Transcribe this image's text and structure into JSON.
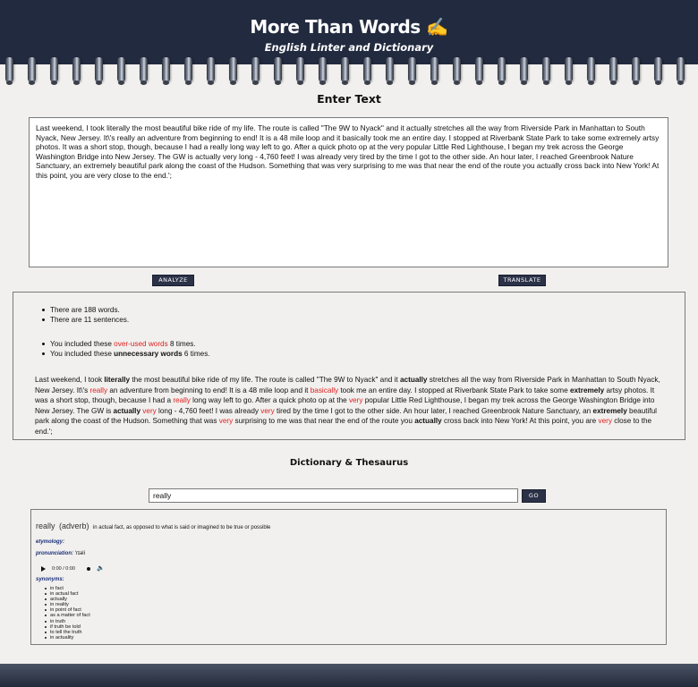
{
  "header": {
    "title": "More Than Words ✍️",
    "subtitle": "English Linter and Dictionary"
  },
  "enter_text": {
    "heading": "Enter Text",
    "input_value": "Last weekend, I took literally the most beautiful bike ride of my life. The route is called \"The 9W to Nyack\" and it actually stretches all the way from Riverside Park in Manhattan to South Nyack, New Jersey. It\\'s really an adventure from beginning to end! It is a 48 mile loop and it basically took me an entire day. I stopped at Riverbank State Park to take some extremely artsy photos. It was a short stop, though, because I had a really long way left to go. After a quick photo op at the very popular Little Red Lighthouse, I began my trek across the George Washington Bridge into New Jersey.  The GW is actually very long - 4,760 feet! I was already very tired by the time I got to the other side. An hour later, I reached Greenbrook Nature Sanctuary, an extremely beautiful park along the coast of the Hudson.  Something that was very surprising to me was that near the end of the route you actually cross back into New York! At this point, you are very close to the end.';",
    "analyze_label": "ANALYZE",
    "translate_label": "TRANSLATE"
  },
  "results": {
    "word_count": "There are 188 words.",
    "sentence_count": "There are 11 sentences.",
    "overused_prefix": "You included these ",
    "overused_link": "over-used words",
    "overused_suffix": " 8 times.",
    "unnecessary_prefix": "You included these ",
    "unnecessary_bold": "unnecessary words",
    "unnecessary_suffix": " 6 times.",
    "analyzed_segments": [
      {
        "t": "Last weekend, I took ",
        "s": "n"
      },
      {
        "t": "literally",
        "s": "b"
      },
      {
        "t": " the most beautiful bike ride of my life. The route is called \"The 9W to Nyack\" and it ",
        "s": "n"
      },
      {
        "t": "actually",
        "s": "b"
      },
      {
        "t": " stretches all the way from Riverside Park in Manhattan to South Nyack, New Jersey. It\\'s ",
        "s": "n"
      },
      {
        "t": "really",
        "s": "r"
      },
      {
        "t": " an adventure from beginning to end! It is a 48 mile loop and it ",
        "s": "n"
      },
      {
        "t": "basically",
        "s": "r"
      },
      {
        "t": " took me an entire day. I stopped at Riverbank State Park to take some ",
        "s": "n"
      },
      {
        "t": "extremely",
        "s": "b"
      },
      {
        "t": " artsy photos. It was a short stop, though, because I had a ",
        "s": "n"
      },
      {
        "t": "really",
        "s": "r"
      },
      {
        "t": " long way left to go. After a quick photo op at the ",
        "s": "n"
      },
      {
        "t": "very",
        "s": "r"
      },
      {
        "t": " popular Little Red Lighthouse, I began my trek across the George Washington Bridge into New Jersey. The GW is ",
        "s": "n"
      },
      {
        "t": "actually",
        "s": "b"
      },
      {
        "t": " ",
        "s": "n"
      },
      {
        "t": "very",
        "s": "r"
      },
      {
        "t": " long - 4,760 feet! I was already ",
        "s": "n"
      },
      {
        "t": "very",
        "s": "r"
      },
      {
        "t": " tired by the time I got to the other side. An hour later, I reached Greenbrook Nature Sanctuary, an ",
        "s": "n"
      },
      {
        "t": "extremely",
        "s": "b"
      },
      {
        "t": " beautiful park along the coast of the Hudson. Something that was ",
        "s": "n"
      },
      {
        "t": "very",
        "s": "r"
      },
      {
        "t": " surprising to me was that near the end of the route you ",
        "s": "n"
      },
      {
        "t": "actually",
        "s": "b"
      },
      {
        "t": " cross back into New York! At this point, you are ",
        "s": "n"
      },
      {
        "t": "very",
        "s": "r"
      },
      {
        "t": " close to the end.';",
        "s": "n"
      }
    ]
  },
  "dictionary": {
    "heading": "Dictionary & Thesaurus",
    "search_value": "really",
    "go_label": "GO",
    "word": "really",
    "part_of_speech": "(adverb)",
    "definition": "in actual fact, as opposed to what is said or imagined to be true or possible",
    "etymology_label": "etymology:",
    "pronunciation_label": "pronunciation:",
    "pronunciation_value": "'rɪəli",
    "audio_time": "0:00 / 0:00",
    "synonyms_label": "synonyms:",
    "synonyms": [
      "in fact",
      "in actual fact",
      "actually",
      "in reality",
      "in point of fact",
      "as a matter of fact",
      "in truth",
      "if truth be told",
      "to tell the truth",
      "in actuality"
    ]
  },
  "colors": {
    "header_bg": "#222a3f",
    "button_bg": "#2b3147",
    "overused_red": "#e02020",
    "label_blue": "#1b2f7a",
    "page_bg": "#f1f0ee"
  },
  "icons": {
    "play": "play-icon",
    "volume": "volume-icon",
    "progress_dot": "progress-dot-icon",
    "writing_hand": "writing-hand-icon"
  }
}
